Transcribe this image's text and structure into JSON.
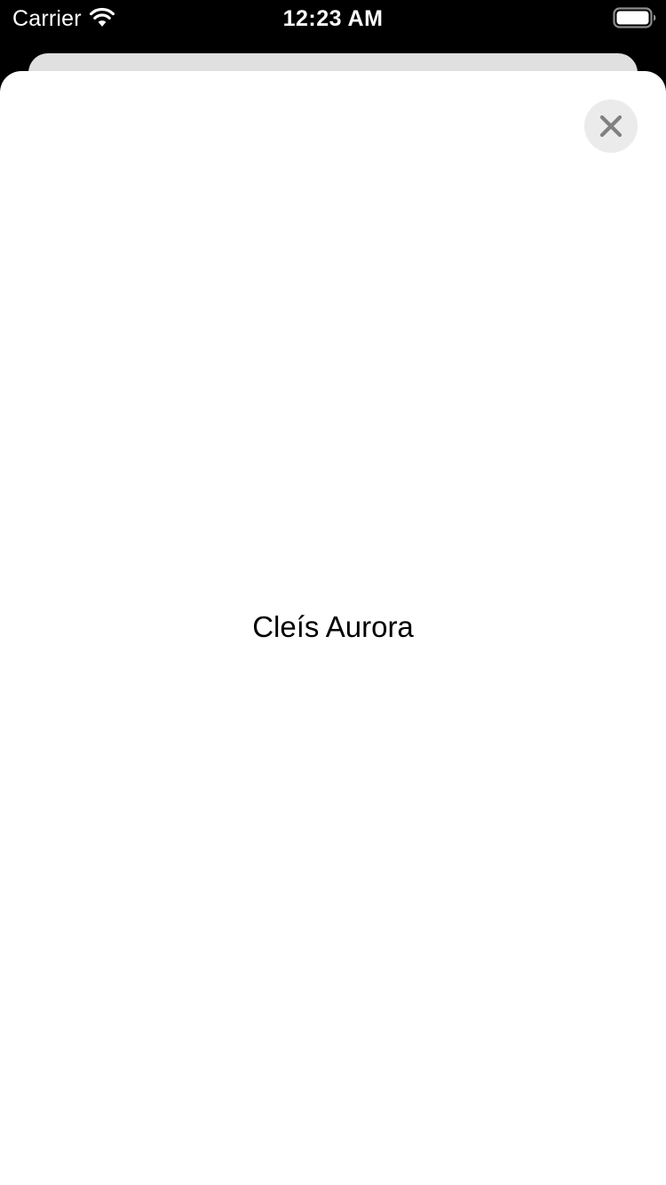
{
  "status_bar": {
    "carrier": "Carrier",
    "time": "12:23 AM",
    "wifi_icon": "wifi-icon",
    "battery_icon": "battery-full-icon"
  },
  "sheet": {
    "title": "Cleís Aurora",
    "close_icon": "close-icon"
  },
  "colors": {
    "status_bar_background": "#000000",
    "sheet_background": "#ffffff",
    "background_card": "#e0e0e0",
    "close_button_background": "#ebebeb",
    "close_icon": "#808080",
    "title_text": "#000000"
  }
}
